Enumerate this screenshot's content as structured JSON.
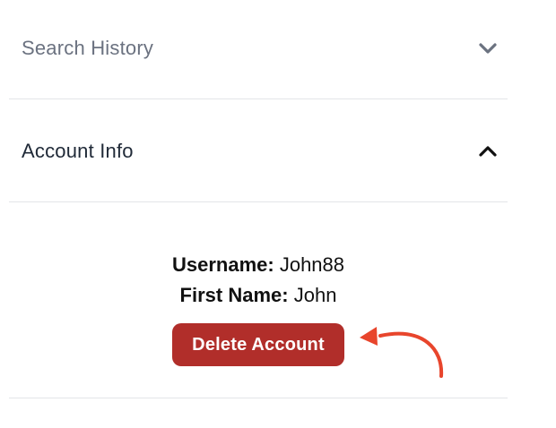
{
  "accordion": {
    "sections": [
      {
        "title": "Search History",
        "state": "collapsed",
        "icon": "chevron-down-icon"
      },
      {
        "title": "Account Info",
        "state": "expanded",
        "icon": "chevron-up-icon"
      }
    ],
    "account_info": {
      "username_label": "Username:",
      "username_value": "John88",
      "first_name_label": "First Name:",
      "first_name_value": "John",
      "delete_button_label": "Delete Account"
    }
  },
  "annotation": {
    "icon": "curved-arrow-icon",
    "color": "#e8452c"
  },
  "colors": {
    "danger": "#b12e2a",
    "divider": "#e3e5e8",
    "muted_text": "#6b7280",
    "strong_text": "#1f2937"
  }
}
